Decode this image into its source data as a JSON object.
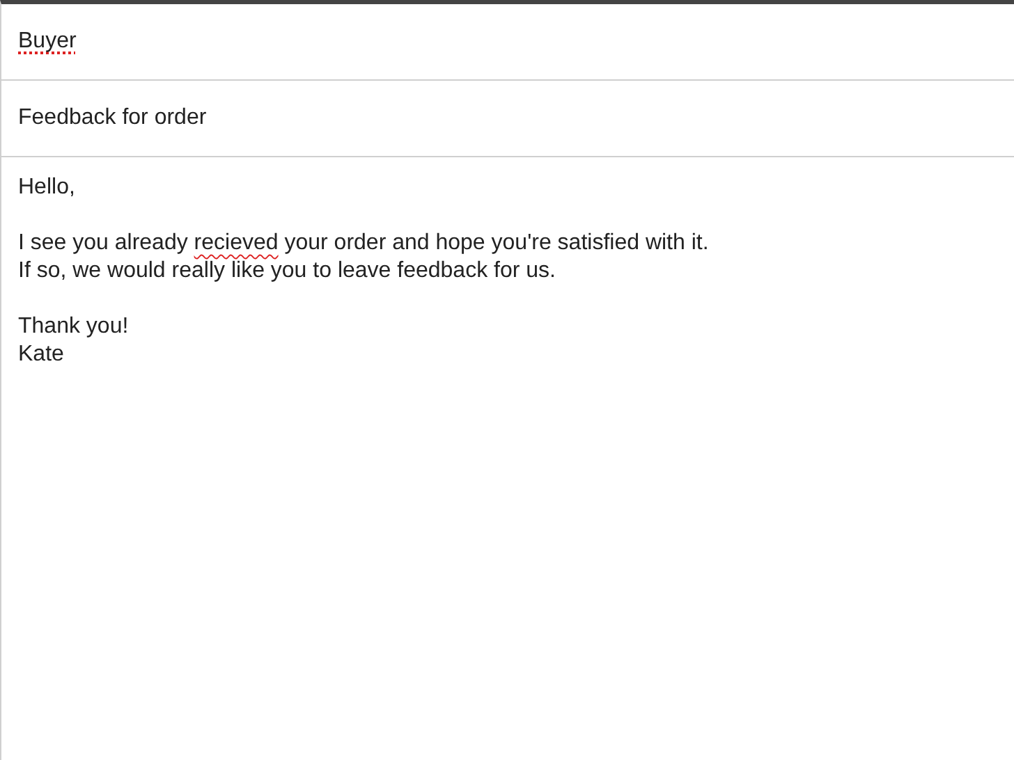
{
  "recipient": {
    "value": "Buyer",
    "misspelled": true
  },
  "subject": {
    "value": "Feedback for order"
  },
  "body": {
    "paragraphs": [
      [
        [
          {
            "text": "Hello,",
            "misspelled": false
          }
        ]
      ],
      [
        [
          {
            "text": "I see you already ",
            "misspelled": false
          },
          {
            "text": "recieved",
            "misspelled": true
          },
          {
            "text": " your order and hope you're satisfied with it.",
            "misspelled": false
          }
        ],
        [
          {
            "text": "If so, we would really like you to leave feedback for us.",
            "misspelled": false
          }
        ]
      ],
      [
        [
          {
            "text": "Thank you!",
            "misspelled": false
          }
        ],
        [
          {
            "text": "Kate",
            "misspelled": false
          }
        ]
      ]
    ]
  }
}
